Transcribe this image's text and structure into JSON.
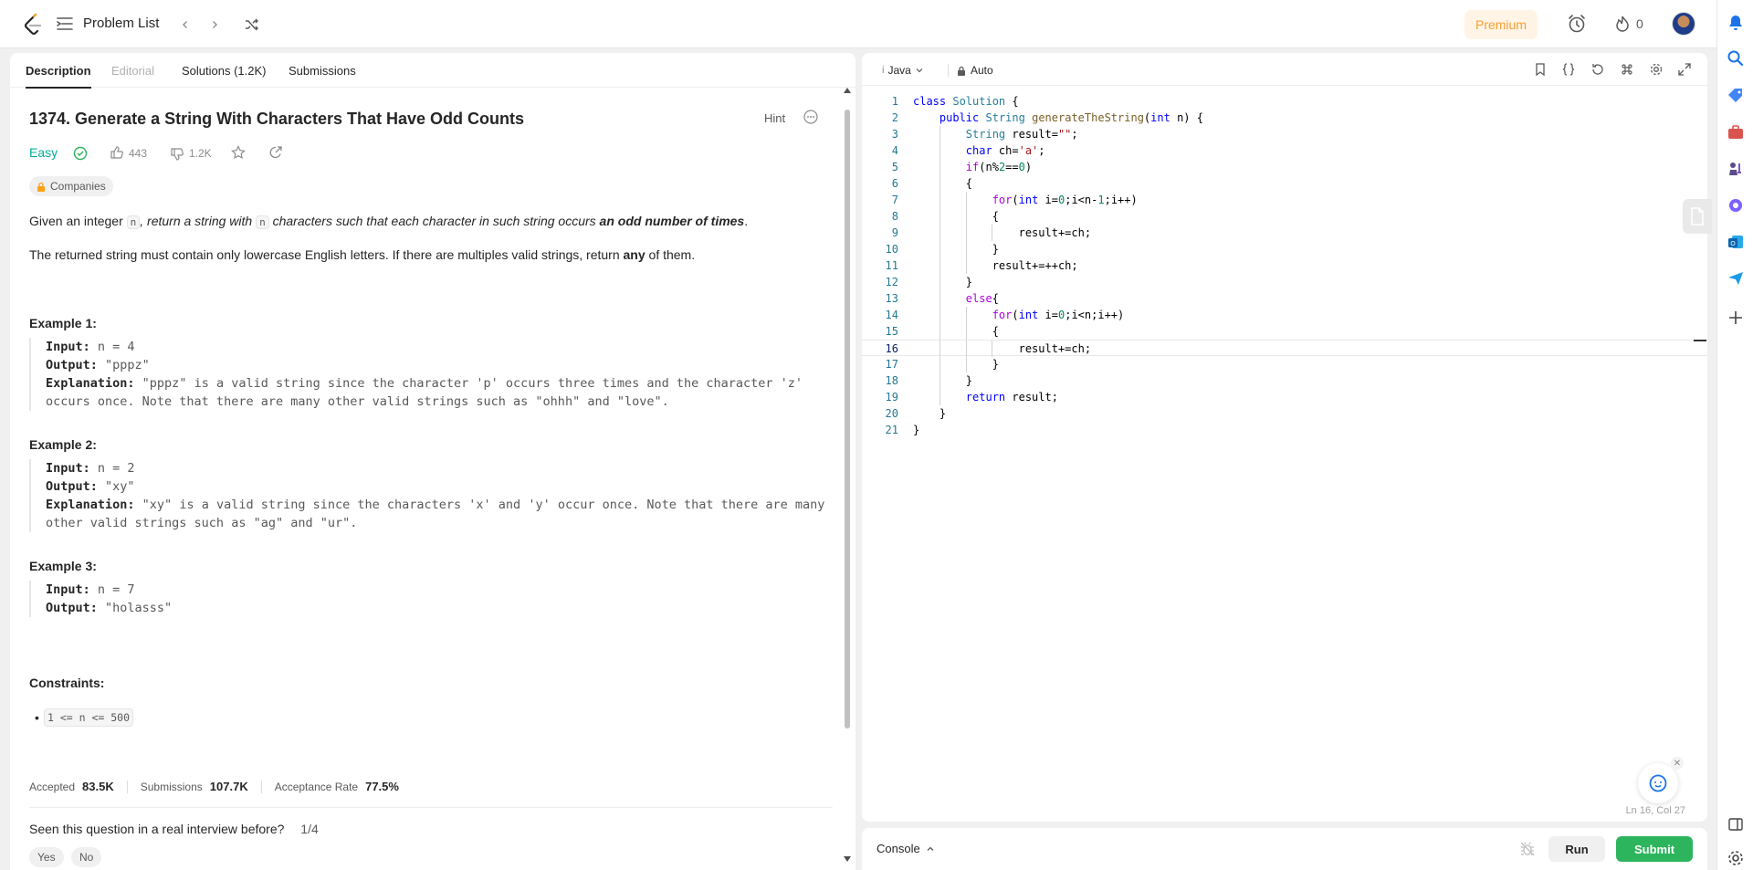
{
  "nav": {
    "problem_list": "Problem List",
    "premium": "Premium",
    "streak": "0"
  },
  "tabs": [
    "Description",
    "Editorial",
    "Solutions (1.2K)",
    "Submissions"
  ],
  "problem": {
    "title": "1374. Generate a String With Characters That Have Odd Counts",
    "hint": "Hint",
    "difficulty": "Easy",
    "likes": "443",
    "dislikes": "1.2K",
    "companies": "Companies",
    "desc1_a": "Given an integer ",
    "desc1_code": "n",
    "desc1_b": ", return a string with ",
    "desc1_code2": "n",
    "desc1_c": " characters such that each character in such string occurs ",
    "desc1_bold": "an odd number of times",
    "desc1_d": ".",
    "desc2_a": "The returned string must contain only lowercase English letters. If there are multiples valid strings, return ",
    "desc2_bold": "any",
    "desc2_b": " of them."
  },
  "examples": [
    {
      "title": "Example 1:",
      "input_label": "Input:",
      "input": " n = 4",
      "output_label": "Output:",
      "output": " \"pppz\"",
      "expl_label": "Explanation:",
      "expl": " \"pppz\" is a valid string since the character 'p' occurs three times and the character 'z' occurs once. Note that there are many other valid strings such as \"ohhh\" and \"love\"."
    },
    {
      "title": "Example 2:",
      "input_label": "Input:",
      "input": " n = 2",
      "output_label": "Output:",
      "output": " \"xy\"",
      "expl_label": "Explanation:",
      "expl": " \"xy\" is a valid string since the characters 'x' and 'y' occur once. Note that there are many other valid strings such as \"ag\" and \"ur\"."
    },
    {
      "title": "Example 3:",
      "input_label": "Input:",
      "input": " n = 7",
      "output_label": "Output:",
      "output": " \"holasss\""
    }
  ],
  "constraints": {
    "title": "Constraints:",
    "item": "1 <= n <= 500"
  },
  "stats": {
    "accepted_label": "Accepted",
    "accepted": "83.5K",
    "submissions_label": "Submissions",
    "submissions": "107.7K",
    "rate_label": "Acceptance Rate",
    "rate": "77.5%"
  },
  "seen": {
    "question": "Seen this question in a real interview before?",
    "count": "1/4",
    "yes": "Yes",
    "no": "No"
  },
  "editor": {
    "language": "Java",
    "mode": "Auto",
    "cursor": "Ln 16, Col 27"
  },
  "code_lines": [
    "class Solution {",
    "    public String generateTheString(int n) {",
    "        String result=\"\";",
    "        char ch='a';",
    "        if(n%2==0)",
    "        {",
    "            for(int i=0;i<n-1;i++)",
    "            {",
    "                result+=ch;",
    "            }",
    "            result+=++ch;",
    "        }",
    "        else{",
    "            for(int i=0;i<n;i++)",
    "            {",
    "                result+=ch;",
    "            }",
    "        }",
    "        return result;",
    "    }",
    "}"
  ],
  "console": {
    "label": "Console",
    "run": "Run",
    "submit": "Submit"
  },
  "colors": {
    "easy": "#00af9b",
    "submit": "#2db55d",
    "premium": "#f59f33"
  }
}
